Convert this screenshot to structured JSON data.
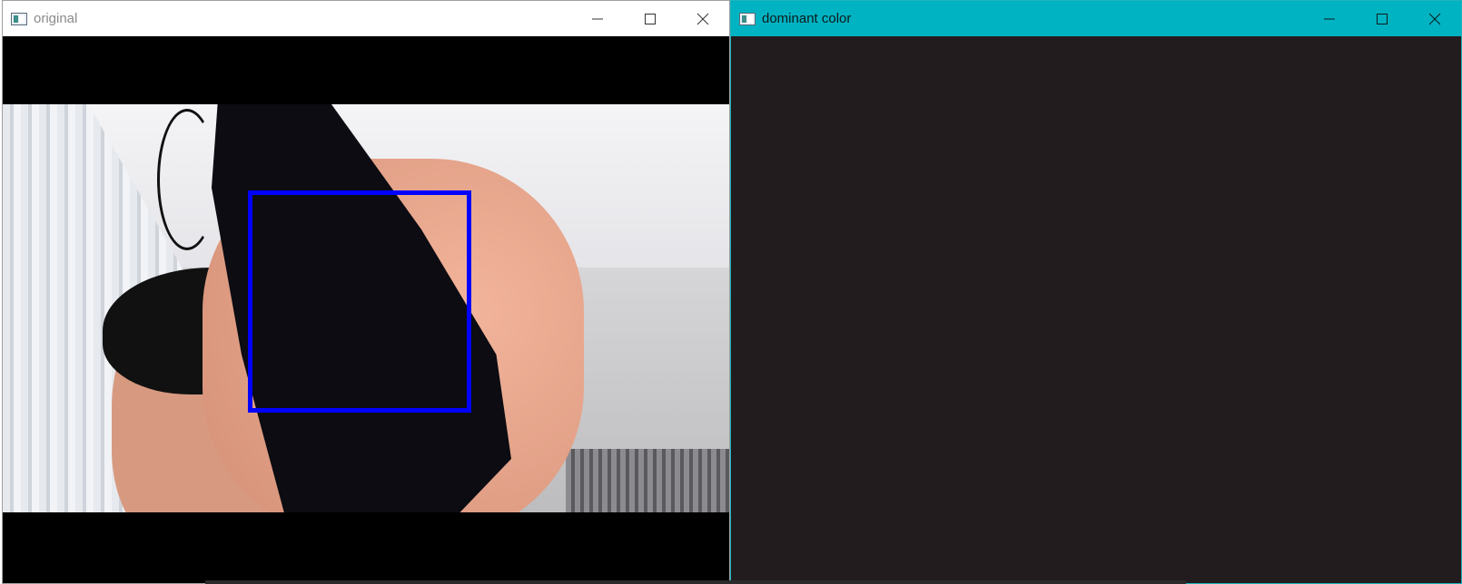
{
  "windows": {
    "original": {
      "title": "original"
    },
    "dominant": {
      "title": "dominant color",
      "swatch_color": "#231c1e"
    }
  },
  "controls": {
    "minimize_icon": "minimize-icon",
    "maximize_icon": "maximize-icon",
    "close_icon": "close-icon"
  },
  "roi": {
    "color": "#0000ff"
  }
}
